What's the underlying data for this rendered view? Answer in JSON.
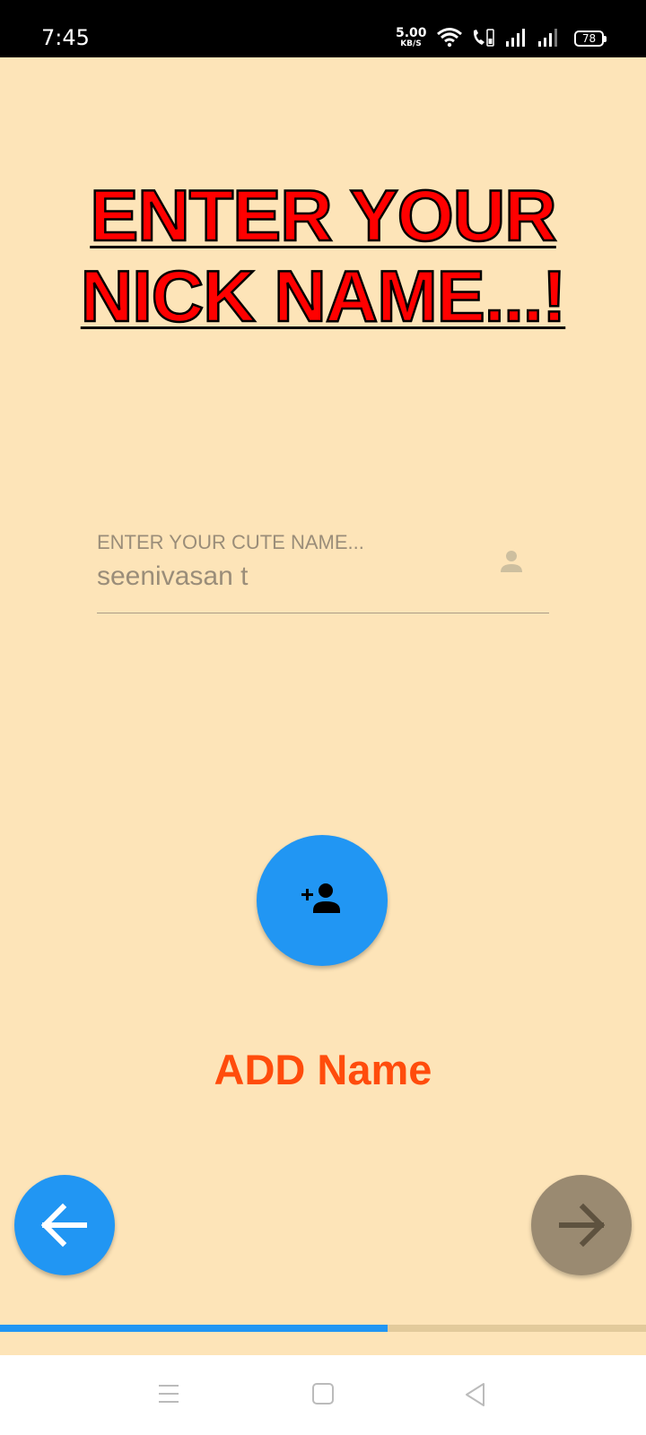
{
  "status_bar": {
    "time": "7:45",
    "net_speed_value": "5.00",
    "net_speed_unit": "KB/S",
    "battery": "78"
  },
  "heading": "ENTER YOUR NICK NAME...!",
  "name_field": {
    "label": "ENTER YOUR CUTE NAME...",
    "value": "seenivasan t"
  },
  "add_button_label": "ADD Name",
  "progress": {
    "fraction": 0.6
  },
  "colors": {
    "background": "#fde4b8",
    "accent": "#2196f3",
    "heading": "#ff0000",
    "add_label": "#ff4c0c",
    "next_disabled": "#9a8a71"
  },
  "icons": {
    "field": "person-icon",
    "add": "person-add-icon",
    "back": "arrow-left-icon",
    "next": "arrow-right-icon"
  }
}
